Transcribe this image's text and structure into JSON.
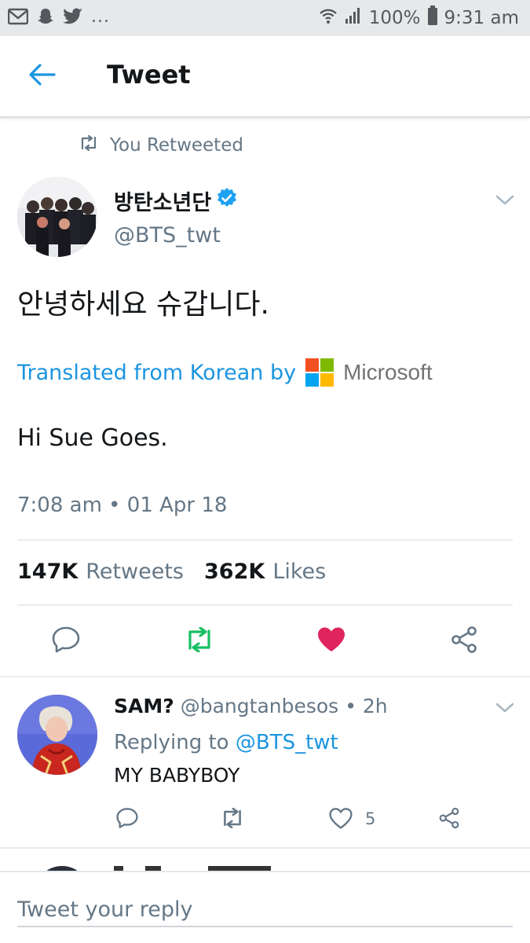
{
  "status_bar": {
    "overflow": "...",
    "battery": "100%",
    "time": "9:31 am"
  },
  "header": {
    "title": "Tweet"
  },
  "tweet": {
    "retweet_context": "You Retweeted",
    "author_name": "방탄소년단",
    "author_handle": "@BTS_twt",
    "text": "안녕하세요 슈갑니다.",
    "translated_label": "Translated from Korean by",
    "translator": "Microsoft",
    "translated_text": "Hi Sue Goes.",
    "timestamp": "7:08 am • 01 Apr 18",
    "retweets_count": "147K",
    "retweets_label": "Retweets",
    "likes_count": "362K",
    "likes_label": "Likes"
  },
  "reply": {
    "name": "SAM?",
    "handle": "@bangtanbesos",
    "time": "• 2h",
    "replying_label": "Replying to",
    "replying_to": "@BTS_twt",
    "text": "MY BABYBOY",
    "like_count": "5"
  },
  "compose": {
    "placeholder": "Tweet your reply"
  },
  "colors": {
    "accent": "#1b95e0",
    "retweet_green": "#17bf63",
    "like_red": "#e0245e",
    "muted": "#657786"
  },
  "icons": {
    "back": "arrow-left-icon",
    "retweet": "retweet-icon",
    "verified": "verified-badge-icon",
    "reply": "reply-icon",
    "like": "heart-icon",
    "share": "share-icon"
  }
}
